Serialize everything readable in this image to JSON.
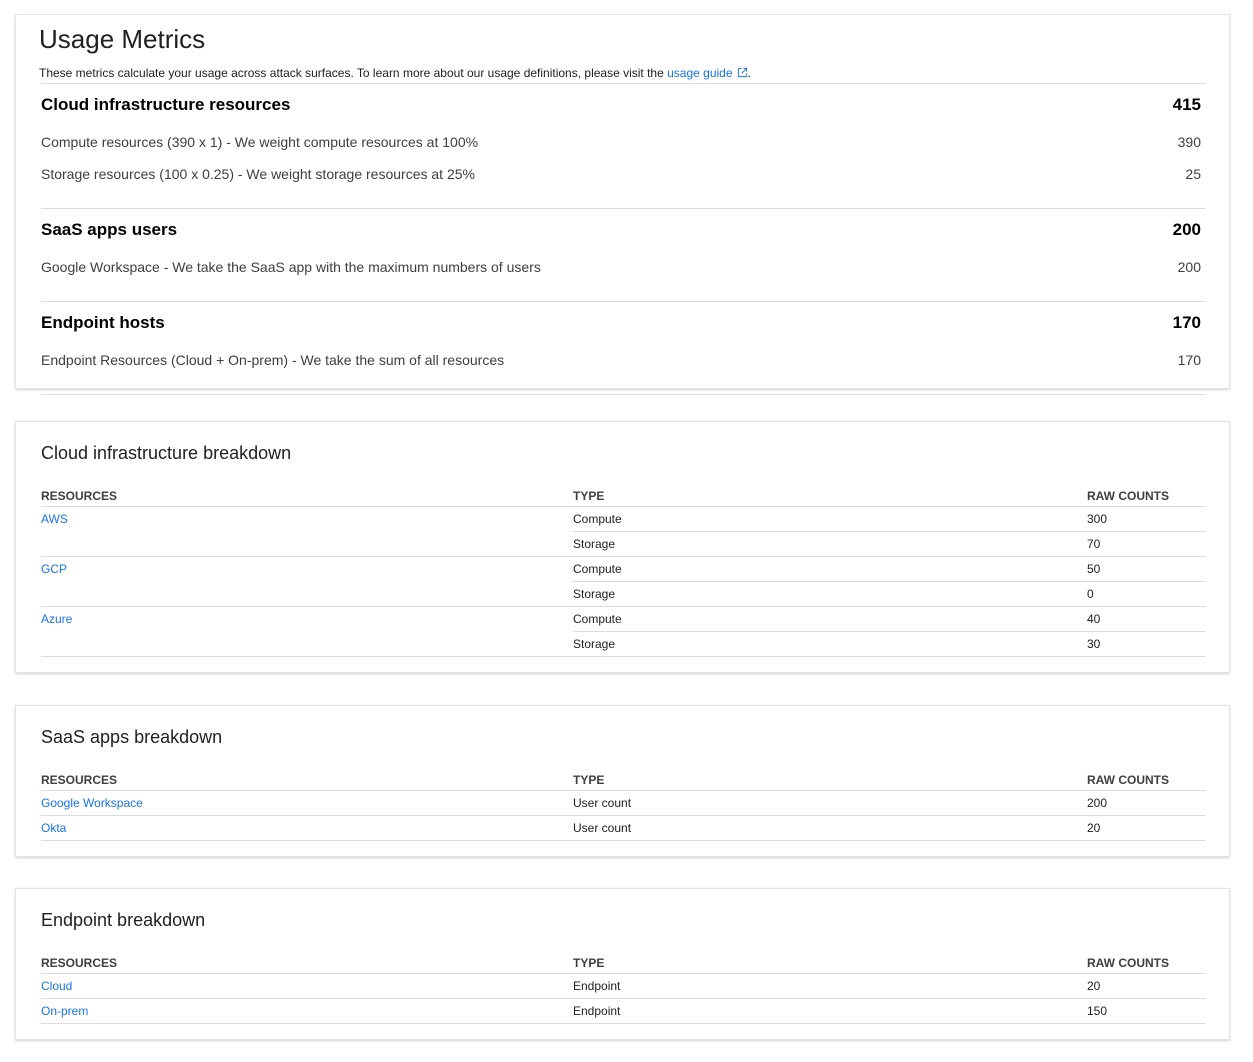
{
  "usage": {
    "title": "Usage Metrics",
    "description": "These metrics calculate your usage across attack surfaces. To learn more about our usage definitions, please visit the",
    "link_label": "usage guide",
    "after_link": ".",
    "link_icon": "external-link-icon",
    "sections": [
      {
        "label": "Cloud infrastructure resources",
        "value": "415",
        "items": [
          {
            "label": "Compute resources (390 x 1) - We weight compute resources at 100%",
            "value": "390"
          },
          {
            "label": "Storage resources (100 x 0.25) - We weight storage resources at 25%",
            "value": "25"
          }
        ]
      },
      {
        "label": "SaaS apps users",
        "value": "200",
        "items": [
          {
            "label": "Google Workspace - We take the SaaS app with the maximum numbers of users",
            "value": "200"
          }
        ]
      },
      {
        "label": "Endpoint hosts",
        "value": "170",
        "items": [
          {
            "label": "Endpoint Resources (Cloud + On-prem) - We take the sum of all resources",
            "value": "170"
          }
        ]
      }
    ]
  },
  "cloud_breakdown": {
    "title": "Cloud infrastructure breakdown",
    "headers": [
      "RESOURCES",
      "TYPE",
      "RAW COUNTS"
    ],
    "rows": [
      {
        "resource": "AWS",
        "type": "Compute",
        "count": "300"
      },
      {
        "resource": "",
        "type": "Storage",
        "count": "70"
      },
      {
        "resource": "GCP",
        "type": "Compute",
        "count": "50"
      },
      {
        "resource": "",
        "type": "Storage",
        "count": "0"
      },
      {
        "resource": "Azure",
        "type": "Compute",
        "count": "40"
      },
      {
        "resource": "",
        "type": "Storage",
        "count": "30"
      }
    ]
  },
  "saas_breakdown": {
    "title": "SaaS apps breakdown",
    "headers": [
      "RESOURCES",
      "TYPE",
      "RAW COUNTS"
    ],
    "rows": [
      {
        "resource": "Google Workspace",
        "type": "User count",
        "count": "200"
      },
      {
        "resource": "Okta",
        "type": "User count",
        "count": "20"
      }
    ]
  },
  "endpoint_breakdown": {
    "title": "Endpoint breakdown",
    "headers": [
      "RESOURCES",
      "TYPE",
      "RAW COUNTS"
    ],
    "rows": [
      {
        "resource": "Cloud",
        "type": "Endpoint",
        "count": "20"
      },
      {
        "resource": "On-prem",
        "type": "Endpoint",
        "count": "150"
      }
    ]
  },
  "colors": {
    "link": "#1a73e8",
    "divider": "#dadce0",
    "text": "#202124"
  }
}
